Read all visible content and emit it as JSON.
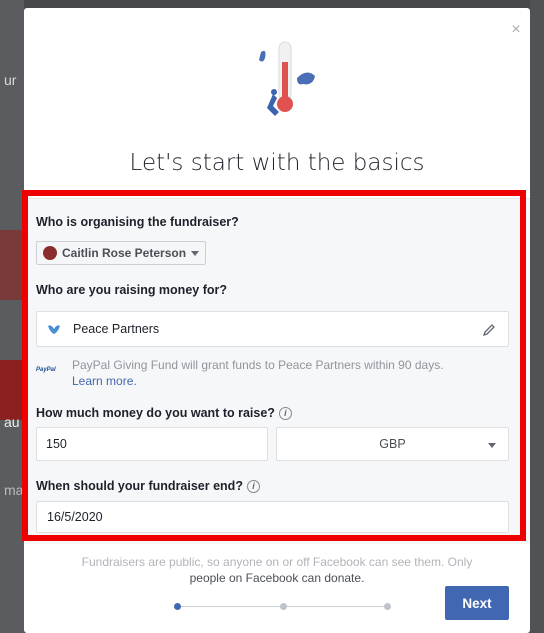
{
  "background": {
    "fragment_1": "ur",
    "fragment_2": "au",
    "fragment_3": "ma"
  },
  "modal": {
    "close_glyph": "×",
    "heading": "Let's start with the basics",
    "organiser": {
      "label": "Who is organising the fundraiser?",
      "selected": "Caitlin Rose Peterson"
    },
    "beneficiary": {
      "label": "Who are you raising money for?",
      "value": "Peace Partners",
      "note": "PayPal Giving Fund will grant funds to Peace Partners within 90 days.",
      "learn_more": "Learn more.",
      "paypal_logo": "PayPal"
    },
    "amount": {
      "label": "How much money do you want to raise?",
      "value": "150",
      "currency": "GBP"
    },
    "end_date": {
      "label": "When should your fundraiser end?",
      "value": "16/5/2020"
    },
    "footer": {
      "line1": "Fundraisers are   public, so anyone on or off Facebook can see them. Only",
      "line2": "people on Facebook can donate."
    },
    "steps": {
      "count": 3,
      "current": 1
    },
    "next_label": "Next"
  },
  "colors": {
    "highlight": "#ee0000",
    "primary_button": "#4267b2",
    "link": "#4267b2"
  },
  "icons": [
    "close-icon",
    "fundraiser-thermometer-illustration",
    "caret-down-icon",
    "charity-logo-icon",
    "pencil-icon",
    "info-icon",
    "paypal-logo"
  ]
}
